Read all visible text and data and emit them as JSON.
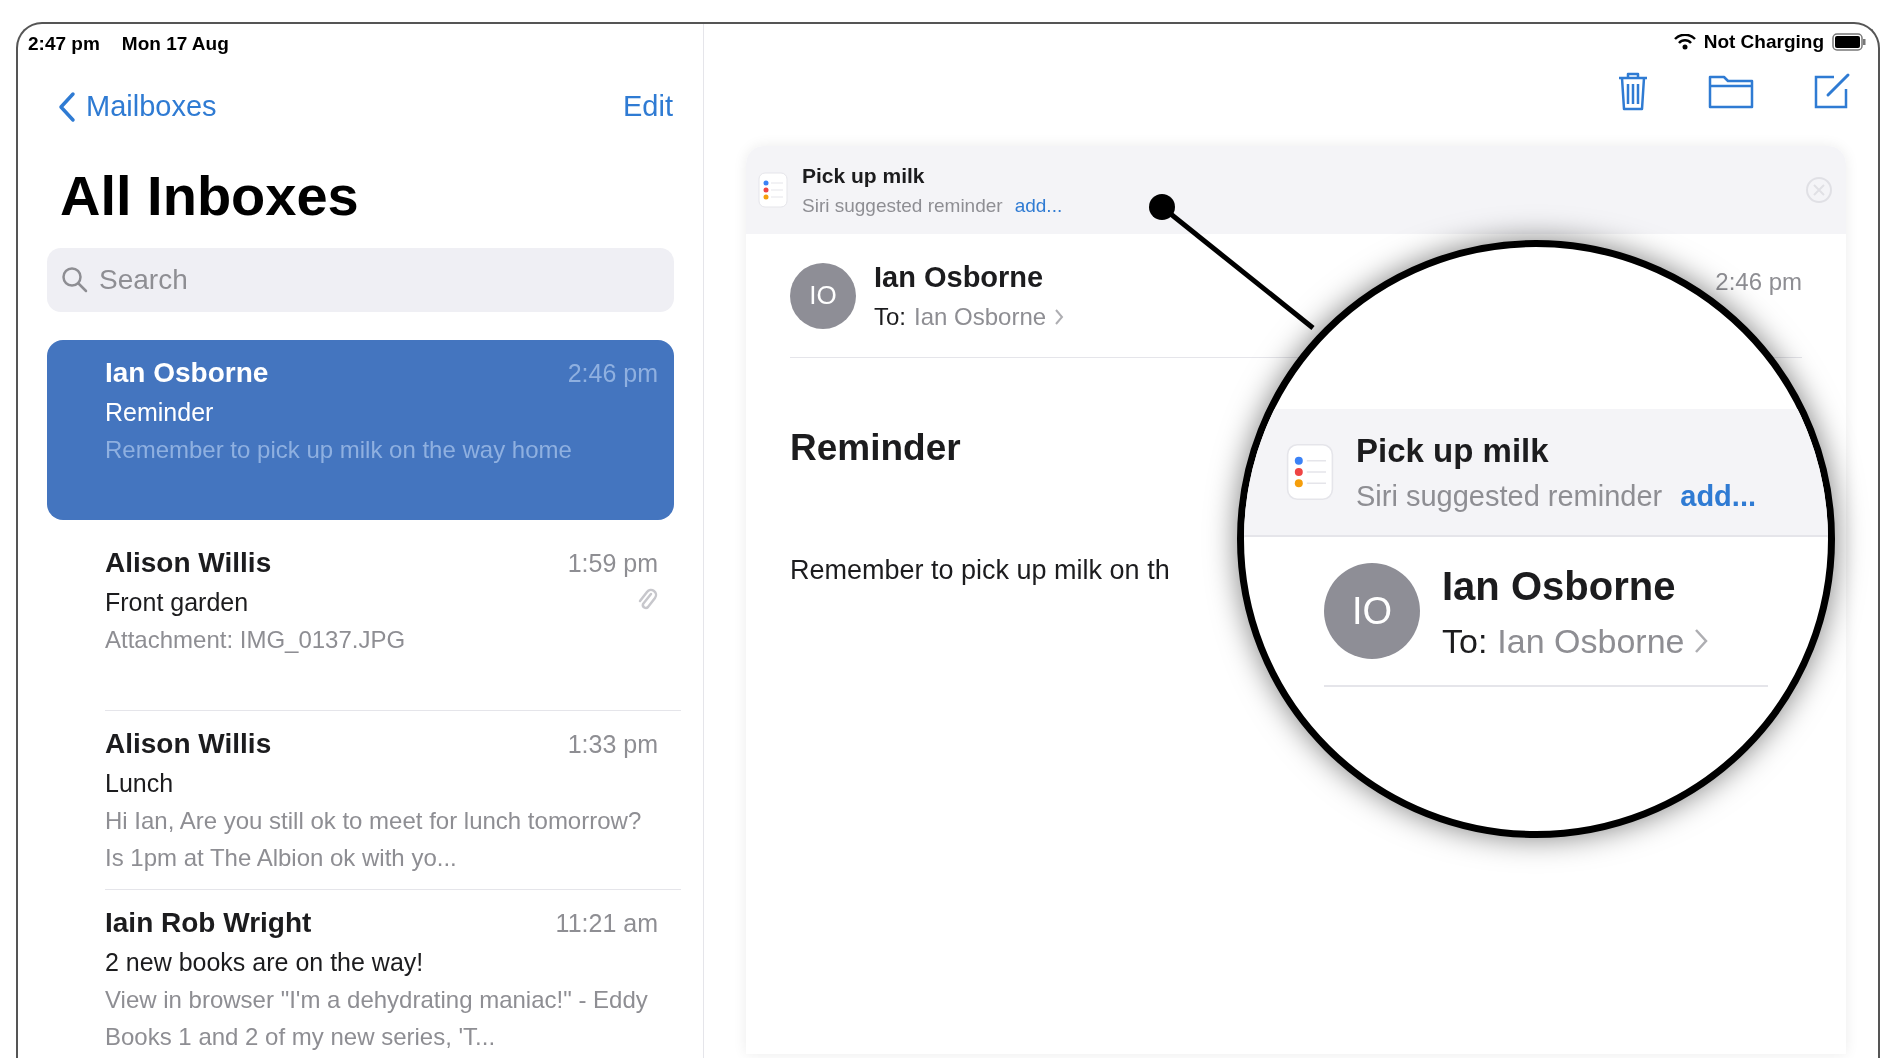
{
  "status_bar": {
    "time": "2:47 pm",
    "date": "Mon 17 Aug",
    "battery_text": "Not Charging"
  },
  "sidebar": {
    "back": "Mailboxes",
    "edit": "Edit",
    "title": "All Inboxes",
    "search": {
      "placeholder": "Search"
    },
    "messages": [
      {
        "sender": "Ian Osborne",
        "time": "2:46 pm",
        "subject": "Reminder",
        "preview": "Remember to pick up milk on the way home",
        "selected": true,
        "attachment": false
      },
      {
        "sender": "Alison Willis",
        "time": "1:59 pm",
        "subject": "Front garden",
        "preview": "Attachment: IMG_0137.JPG",
        "selected": false,
        "attachment": true
      },
      {
        "sender": "Alison Willis",
        "time": "1:33 pm",
        "subject": "Lunch",
        "preview": "Hi Ian, Are you still ok to meet for lunch tomorrow? Is 1pm at The Albion ok with yo...",
        "selected": false,
        "attachment": false
      },
      {
        "sender": "Iain Rob Wright",
        "time": "11:21 am",
        "subject": "2 new books are on the way!",
        "preview": "View in browser \"I'm a dehydrating maniac!\" - Eddy Books 1 and 2 of my new series, 'T...",
        "selected": false,
        "attachment": false
      }
    ]
  },
  "suggestion": {
    "title": "Pick up milk",
    "subtitle": "Siri suggested reminder",
    "action": "add..."
  },
  "message": {
    "avatar": "IO",
    "sender": "Ian Osborne",
    "to_label": "To:",
    "to": "Ian Osborne",
    "time": "2:46 pm",
    "subject": "Reminder",
    "body": "Remember to pick up milk on th"
  },
  "magnifier": {
    "title": "Pick up milk",
    "subtitle": "Siri suggested reminder",
    "action": "add...",
    "avatar": "IO",
    "sender": "Ian Osborne",
    "to_label": "To:",
    "to": "Ian Osborne"
  }
}
